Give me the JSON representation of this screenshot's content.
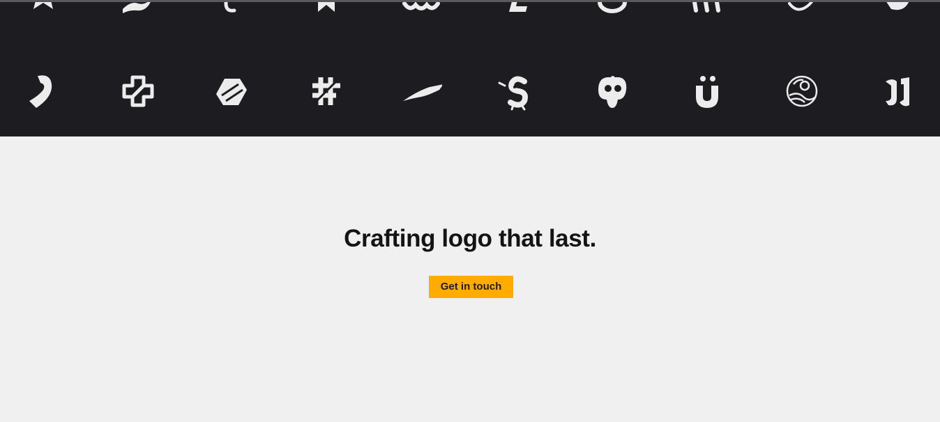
{
  "logo_band": {
    "background": "#1d1c21",
    "logo_color": "#ececec",
    "top_row_icons": [
      "star-person-logo-icon",
      "swoosh-logo-icon",
      "script-c-logo-icon",
      "star-badge-logo-icon",
      "wave-logo-icon",
      "letter-e-logo-icon",
      "ring-logo-icon",
      "bars-logo-icon",
      "flourish-logo-icon",
      "leaf-logo-icon"
    ],
    "bottom_row_icons": [
      "hook-logo-icon",
      "cross-link-logo-icon",
      "folded-s-logo-icon",
      "hash-f-logo-icon",
      "wing-logo-icon",
      "s-mascot-logo-icon",
      "face-logo-icon",
      "u-umlaut-logo-icon",
      "globe-woman-logo-icon",
      "double-j-logo-icon"
    ]
  },
  "hero": {
    "headline": "Crafting logo that last.",
    "cta_label": "Get in touch",
    "cta_color": "#ffab00"
  }
}
